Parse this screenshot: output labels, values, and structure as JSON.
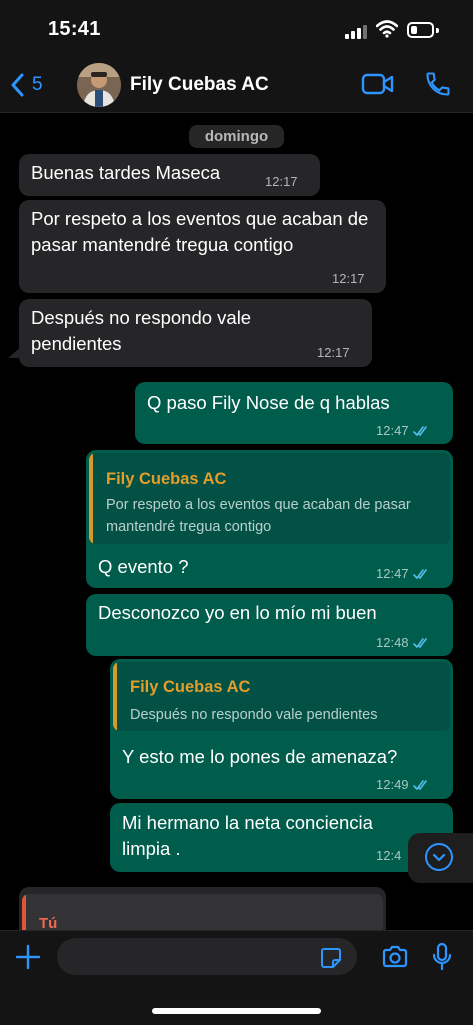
{
  "status_bar": {
    "time": "15:41",
    "battery_level": 0.3
  },
  "header": {
    "back_count": "5",
    "contact_name": "Fily Cuebas AC",
    "accent_color": "#2e95ff"
  },
  "chat": {
    "date_label": "domingo",
    "messages": [
      {
        "direction": "in",
        "text": "Buenas tardes Maseca",
        "time": "12:17"
      },
      {
        "direction": "in",
        "text": "Por respeto a los eventos que acaban de pasar mantendré tregua contigo",
        "time": "12:17"
      },
      {
        "direction": "in",
        "text": "Después no respondo vale pendientes",
        "time": "12:17"
      },
      {
        "direction": "out",
        "text": "Q paso Fily Nose de q hablas",
        "time": "12:47",
        "status": "read"
      },
      {
        "direction": "out",
        "quote_author": "Fily Cuebas AC",
        "quote_text": "Por respeto a los eventos que acaban de pasar mantendré tregua contigo",
        "text": "Q evento ?",
        "time": "12:47",
        "status": "read"
      },
      {
        "direction": "out",
        "text": "Desconozco yo en lo mío mi buen",
        "time": "12:48",
        "status": "read"
      },
      {
        "direction": "out",
        "quote_author": "Fily Cuebas AC",
        "quote_text": "Después no respondo vale pendientes",
        "text": "Y esto me lo pones de amenaza?",
        "time": "12:49",
        "status": "read"
      },
      {
        "direction": "out",
        "text": "Mi hermano la neta conciencia limpia .",
        "time": "12:4"
      },
      {
        "direction": "in",
        "quote_author": "Tú",
        "text": ""
      }
    ]
  },
  "colors": {
    "incoming_bubble": "#262628",
    "outgoing_bubble": "#005c4b",
    "quote_author": "#e29d2b",
    "read_ticks": "#53bdeb"
  },
  "icons": {
    "back": "chevron-left-icon",
    "video": "video-camera-icon",
    "call": "phone-icon",
    "scroll": "chevron-down-icon",
    "plus": "plus-icon",
    "sticker": "sticker-icon",
    "camera": "camera-icon",
    "mic": "microphone-icon"
  }
}
